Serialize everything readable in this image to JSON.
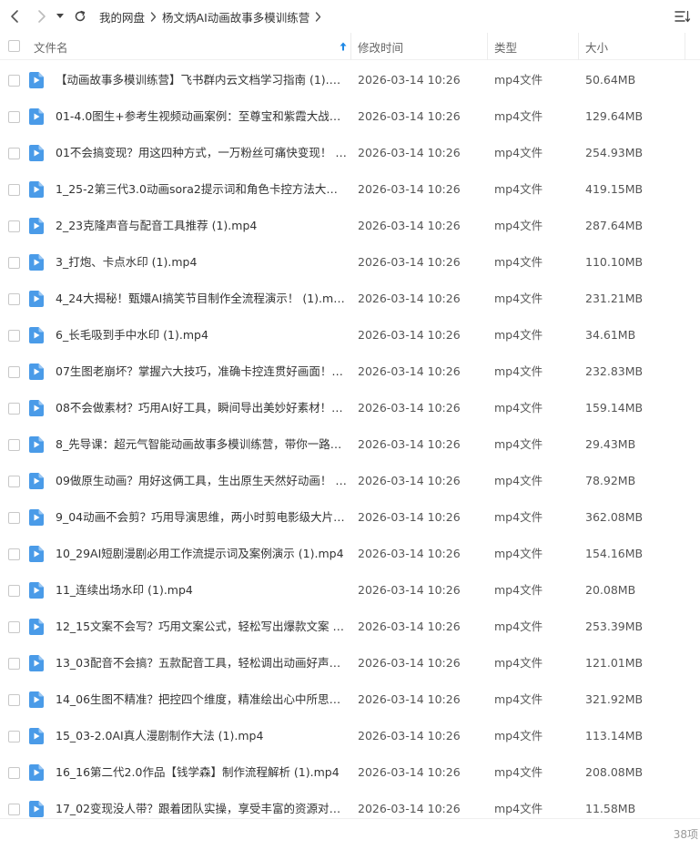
{
  "toolbar": {
    "breadcrumb": [
      "我的网盘",
      "杨文炳AI动画故事多模训练营"
    ]
  },
  "header": {
    "name": "文件名",
    "time": "修改时间",
    "type": "类型",
    "size": "大小"
  },
  "files": [
    {
      "name": "【动画故事多模训练营】飞书群内云文档学习指南 (1).mp4",
      "time": "2026-03-14 10:26",
      "type": "mp4文件",
      "size": "50.64MB"
    },
    {
      "name": "01-4.0图生+参考生视频动画案例：至尊宝和紫霞大战主...",
      "time": "2026-03-14 10:26",
      "type": "mp4文件",
      "size": "129.64MB"
    },
    {
      "name": "01不会搞变现？用这四种方式，一万粉丝可痛快变现！ (1...",
      "time": "2026-03-14 10:26",
      "type": "mp4文件",
      "size": "254.93MB"
    },
    {
      "name": "1_25-2第三代3.0动画sora2提示词和角色卡控方法大揭秘...",
      "time": "2026-03-14 10:26",
      "type": "mp4文件",
      "size": "419.15MB"
    },
    {
      "name": "2_23克隆声音与配音工具推荐 (1).mp4",
      "time": "2026-03-14 10:26",
      "type": "mp4文件",
      "size": "287.64MB"
    },
    {
      "name": "3_打炮、卡点水印 (1).mp4",
      "time": "2026-03-14 10:26",
      "type": "mp4文件",
      "size": "110.10MB"
    },
    {
      "name": "4_24大揭秘！甄嬛AI搞笑节目制作全流程演示！ (1).mp4",
      "time": "2026-03-14 10:26",
      "type": "mp4文件",
      "size": "231.21MB"
    },
    {
      "name": "6_长毛吸到手中水印 (1).mp4",
      "time": "2026-03-14 10:26",
      "type": "mp4文件",
      "size": "34.61MB"
    },
    {
      "name": "07生图老崩坏？掌握六大技巧，准确卡控连贯好画面！②...",
      "time": "2026-03-14 10:26",
      "type": "mp4文件",
      "size": "232.83MB"
    },
    {
      "name": "08不会做素材？巧用AI好工具，瞬间导出美妙好素材！【...",
      "time": "2026-03-14 10:26",
      "type": "mp4文件",
      "size": "159.14MB"
    },
    {
      "name": "8_先导课：超元气智能动画故事多模训练营，带你一路开...",
      "time": "2026-03-14 10:26",
      "type": "mp4文件",
      "size": "29.43MB"
    },
    {
      "name": "09做原生动画？用好这俩工具，生出原生天然好动画！ (1...",
      "time": "2026-03-14 10:26",
      "type": "mp4文件",
      "size": "78.92MB"
    },
    {
      "name": "9_04动画不会剪？巧用导演思维，两小时剪电影级大片！...",
      "time": "2026-03-14 10:26",
      "type": "mp4文件",
      "size": "362.08MB"
    },
    {
      "name": "10_29AI短剧漫剧必用工作流提示词及案例演示 (1).mp4",
      "time": "2026-03-14 10:26",
      "type": "mp4文件",
      "size": "154.16MB"
    },
    {
      "name": "11_连续出场水印 (1).mp4",
      "time": "2026-03-14 10:26",
      "type": "mp4文件",
      "size": "20.08MB"
    },
    {
      "name": "12_15文案不会写？巧用文案公式，轻松写出爆款文案 (1)...",
      "time": "2026-03-14 10:26",
      "type": "mp4文件",
      "size": "253.39MB"
    },
    {
      "name": "13_03配音不会搞？五款配音工具，轻松调出动画好声音...",
      "time": "2026-03-14 10:26",
      "type": "mp4文件",
      "size": "121.01MB"
    },
    {
      "name": "14_06生图不精准？把控四个维度，精准绘出心中所思想...",
      "time": "2026-03-14 10:26",
      "type": "mp4文件",
      "size": "321.92MB"
    },
    {
      "name": "15_03-2.0AI真人漫剧制作大法 (1).mp4",
      "time": "2026-03-14 10:26",
      "type": "mp4文件",
      "size": "113.14MB"
    },
    {
      "name": "16_16第二代2.0作品【钱学森】制作流程解析 (1).mp4",
      "time": "2026-03-14 10:26",
      "type": "mp4文件",
      "size": "208.08MB"
    },
    {
      "name": "17_02变现没人带？跟着团队实操，享受丰富的资源对接...",
      "time": "2026-03-14 10:26",
      "type": "mp4文件",
      "size": "11.58MB"
    }
  ],
  "footer": {
    "count": "38项"
  },
  "colors": {
    "icon_blue": "#4a9be8",
    "sort_arrow": "#1e88e5"
  }
}
